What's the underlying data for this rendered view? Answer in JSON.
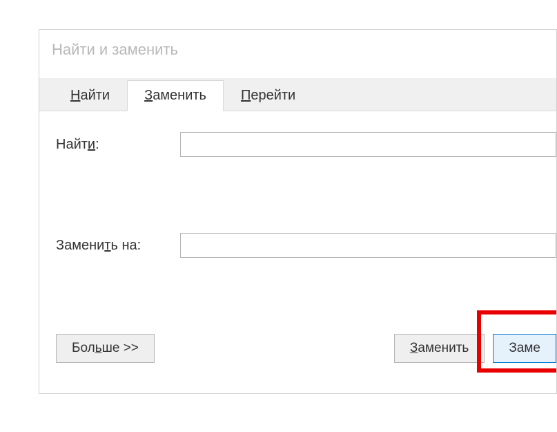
{
  "dialog": {
    "title": "Найти и заменить"
  },
  "tabs": {
    "find": {
      "pre": "",
      "u": "Н",
      "post": "айти"
    },
    "replace": {
      "pre": "",
      "u": "З",
      "post": "аменить"
    },
    "goto": {
      "pre": "",
      "u": "П",
      "post": "ерейти"
    }
  },
  "fields": {
    "find": {
      "pre": "Найт",
      "u": "и",
      "post": ":",
      "value": ""
    },
    "replace": {
      "pre": "Замени",
      "u": "т",
      "post": "ь на:",
      "value": ""
    }
  },
  "buttons": {
    "more": {
      "pre": "Бол",
      "u": "ь",
      "post": "ше >>"
    },
    "replace": {
      "pre": "",
      "u": "З",
      "post": "аменить"
    },
    "replaceAll": {
      "text": "Заме"
    }
  }
}
